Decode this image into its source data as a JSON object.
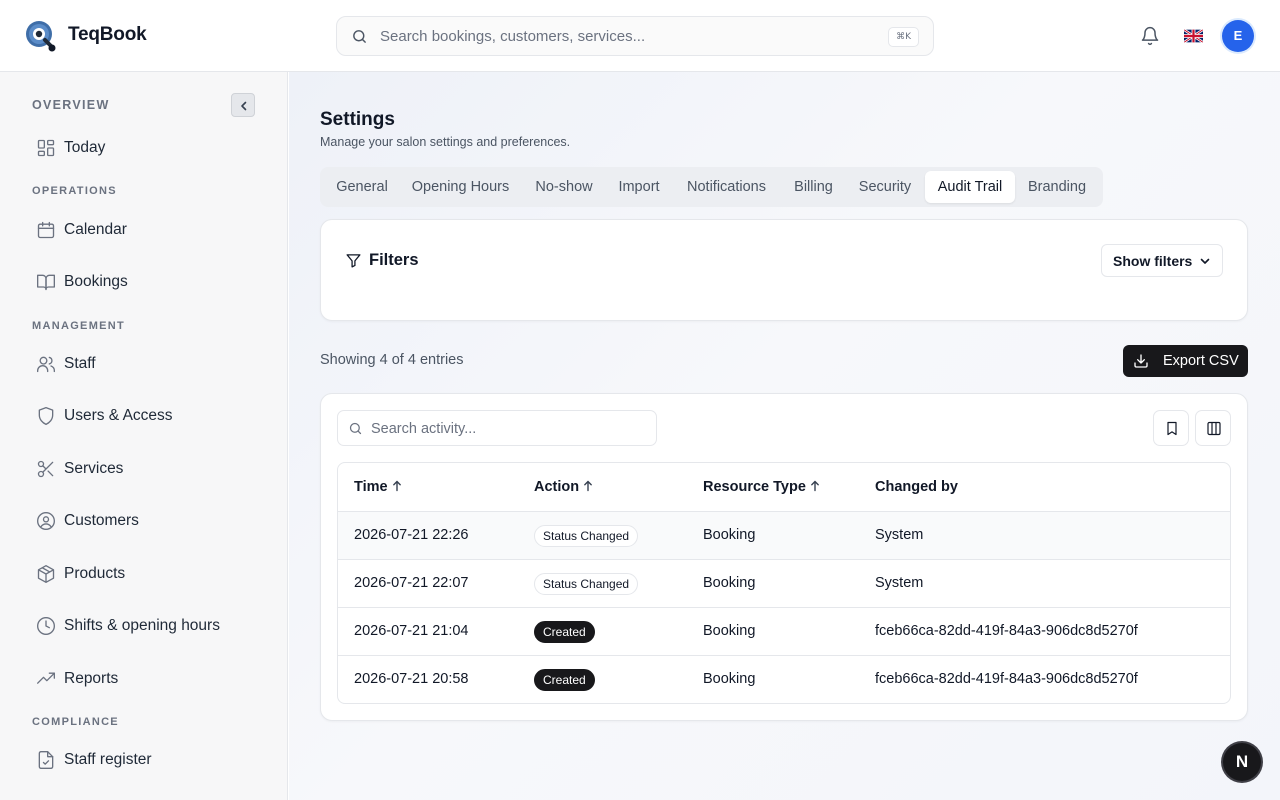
{
  "app": {
    "name": "TeqBook"
  },
  "colors": {
    "accent": "#2563eb",
    "primary_dark": "#18181b",
    "sidebar_bg": "#f7f7f8"
  },
  "header": {
    "search_placeholder": "Search bookings, customers, services...",
    "shortcut": "⌘K",
    "avatar_initial": "E",
    "flag": "uk-flag",
    "notifications_icon": "bell-icon"
  },
  "sidebar": {
    "sections": {
      "overview": "OVERVIEW",
      "operations": "OPERATIONS",
      "management": "MANAGEMENT",
      "compliance": "COMPLIANCE"
    },
    "items": [
      {
        "label": "Today",
        "icon": "layout-grid-icon"
      },
      {
        "label": "Calendar",
        "icon": "calendar-icon"
      },
      {
        "label": "Bookings",
        "icon": "book-open-icon"
      },
      {
        "label": "Staff",
        "icon": "users-icon"
      },
      {
        "label": "Users & Access",
        "icon": "shield-icon"
      },
      {
        "label": "Services",
        "icon": "scissors-icon"
      },
      {
        "label": "Customers",
        "icon": "user-circle-icon"
      },
      {
        "label": "Products",
        "icon": "package-icon"
      },
      {
        "label": "Shifts & opening hours",
        "icon": "clock-icon"
      },
      {
        "label": "Reports",
        "icon": "trending-up-icon"
      },
      {
        "label": "Staff register",
        "icon": "file-check-icon"
      }
    ]
  },
  "page": {
    "title": "Settings",
    "subtitle": "Manage your salon settings and preferences.",
    "tabs": [
      {
        "label": "General",
        "active": false
      },
      {
        "label": "Opening Hours",
        "active": false
      },
      {
        "label": "No-show",
        "active": false
      },
      {
        "label": "Import",
        "active": false
      },
      {
        "label": "Notifications",
        "active": false
      },
      {
        "label": "Billing",
        "active": false
      },
      {
        "label": "Security",
        "active": false
      },
      {
        "label": "Audit Trail",
        "active": true
      },
      {
        "label": "Branding",
        "active": false
      }
    ]
  },
  "filters": {
    "title": "Filters",
    "toggle_label": "Show filters"
  },
  "summary": {
    "showing": "Showing 4 of 4 entries",
    "export_label": "Export CSV"
  },
  "activity": {
    "search_placeholder": "Search activity...",
    "columns": [
      "Time",
      "Action",
      "Resource Type",
      "Changed by"
    ],
    "rows": [
      {
        "time": "2026-07-21 22:26",
        "action": "Status Changed",
        "action_style": "outline",
        "resource": "Booking",
        "changed_by": "System"
      },
      {
        "time": "2026-07-21 22:07",
        "action": "Status Changed",
        "action_style": "outline",
        "resource": "Booking",
        "changed_by": "System"
      },
      {
        "time": "2026-07-21 21:04",
        "action": "Created",
        "action_style": "solid",
        "resource": "Booking",
        "changed_by": "fceb66ca-82dd-419f-84a3-906dc8d5270f"
      },
      {
        "time": "2026-07-21 20:58",
        "action": "Created",
        "action_style": "solid",
        "resource": "Booking",
        "changed_by": "fceb66ca-82dd-419f-84a3-906dc8d5270f"
      }
    ]
  },
  "floating": {
    "label": "N"
  }
}
